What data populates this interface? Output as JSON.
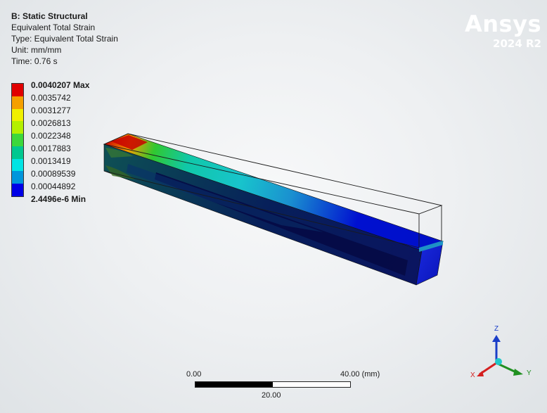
{
  "header": {
    "title": "B: Static Structural",
    "result_name": "Equivalent Total Strain",
    "type_line": "Type: Equivalent Total Strain",
    "unit_line": "Unit: mm/mm",
    "time_line": "Time: 0.76 s"
  },
  "legend": {
    "labels": [
      "0.0040207 Max",
      "0.0035742",
      "0.0031277",
      "0.0026813",
      "0.0022348",
      "0.0017883",
      "0.0013419",
      "0.00089539",
      "0.00044892",
      "2.4496e-6 Min"
    ],
    "colors": [
      "#e00000",
      "#f5a000",
      "#f0f000",
      "#b4f000",
      "#3cd83c",
      "#00c890",
      "#00e4e4",
      "#0096dc",
      "#0000e6"
    ]
  },
  "logo": {
    "brand": "Ansys",
    "version": "2024 R2"
  },
  "scale_bar": {
    "left_label": "0.00",
    "right_label": "40.00 (mm)",
    "mid_label": "20.00"
  },
  "triad": {
    "x_label": "X",
    "y_label": "Y",
    "z_label": "Z",
    "colors": {
      "x": "#d42020",
      "y": "#209020",
      "z": "#1a3ec8",
      "origin": "#20c8c8"
    }
  }
}
